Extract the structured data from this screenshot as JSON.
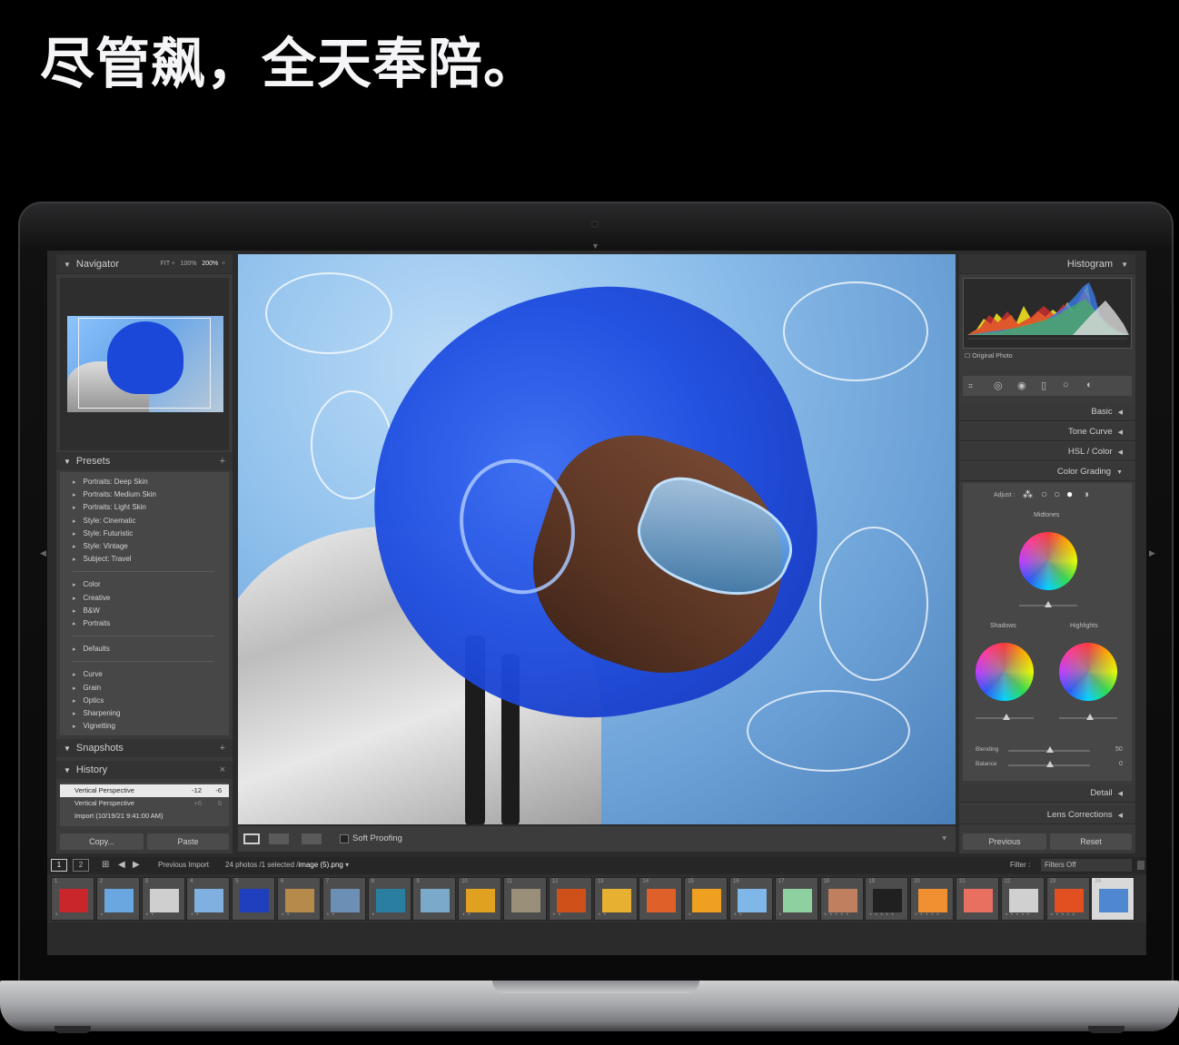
{
  "headline": "尽管飙，全天奉陪。",
  "navigator": {
    "title": "Navigator",
    "zoom_options": [
      "FIT ÷",
      "100%",
      "200%",
      "÷"
    ]
  },
  "presets": {
    "title": "Presets",
    "groups": [
      [
        "Portraits: Deep Skin",
        "Portraits: Medium Skin",
        "Portraits: Light Skin",
        "Style: Cinematic",
        "Style: Futuristic",
        "Style: Vintage",
        "Subject: Travel"
      ],
      [
        "Color",
        "Creative",
        "B&W",
        "Portraits"
      ],
      [
        "Defaults"
      ],
      [
        "Curve",
        "Grain",
        "Optics",
        "Sharpening",
        "Vignetting"
      ]
    ]
  },
  "snapshots": {
    "title": "Snapshots"
  },
  "history": {
    "title": "History",
    "rows": [
      {
        "label": "Vertical Perspective",
        "v1": "-12",
        "v2": "-6"
      },
      {
        "label": "Vertical Perspective",
        "v1": "+6",
        "v2": "6"
      },
      {
        "label": "Import (10/19/21 9:41:00 AM)",
        "v1": "",
        "v2": ""
      }
    ]
  },
  "left_buttons": {
    "copy": "Copy...",
    "paste": "Paste"
  },
  "histogram": {
    "title": "Histogram",
    "original_photo": "Original Photo"
  },
  "right_sections": [
    "Basic",
    "Tone Curve",
    "HSL / Color",
    "Color Grading"
  ],
  "color_grading": {
    "adjust_label": "Adjust :",
    "midtones": "Midtones",
    "shadows": "Shadows",
    "highlights": "Highlights",
    "blending_label": "Blending",
    "blending_value": "50",
    "balance_label": "Balance",
    "balance_value": "0"
  },
  "bottom_sections": [
    "Detail",
    "Lens Corrections"
  ],
  "right_buttons": {
    "previous": "Previous",
    "reset": "Reset"
  },
  "toolbar": {
    "soft_proofing": "Soft Proofing"
  },
  "filmbar": {
    "view1": "1",
    "view2": "2",
    "source": "Previous Import",
    "count": "24 photos /1 selected /",
    "filename": "image (5).png",
    "filter_label": "Filter :",
    "filter_value": "Filters Off"
  },
  "filmstrip": {
    "thumb_colors": [
      "#c8262a",
      "#6aa6e0",
      "#cfcfcf",
      "#7fb0e0",
      "#1f3fbf",
      "#b58a4a",
      "#6c8fb5",
      "#2a7fa0",
      "#7aa9c9",
      "#e0a020",
      "#9a8f78",
      "#d0501a",
      "#e8b030",
      "#e0602a",
      "#f0a020",
      "#7fb8e8",
      "#8fd0a0",
      "#c08060",
      "#202020",
      "#f09030",
      "#e87060",
      "#d0d0d0",
      "#e05020",
      "#4f88d0"
    ],
    "star_rows": [
      "*",
      "*",
      "* *",
      "* *",
      "",
      "* *",
      "* *",
      "*",
      "",
      "* *",
      "",
      "* *",
      "* *",
      "",
      "*",
      "* *",
      "*",
      "* * * * *",
      "* * * * *",
      "* * * * *",
      "",
      "* * * * *",
      "* * * * *",
      ""
    ]
  }
}
